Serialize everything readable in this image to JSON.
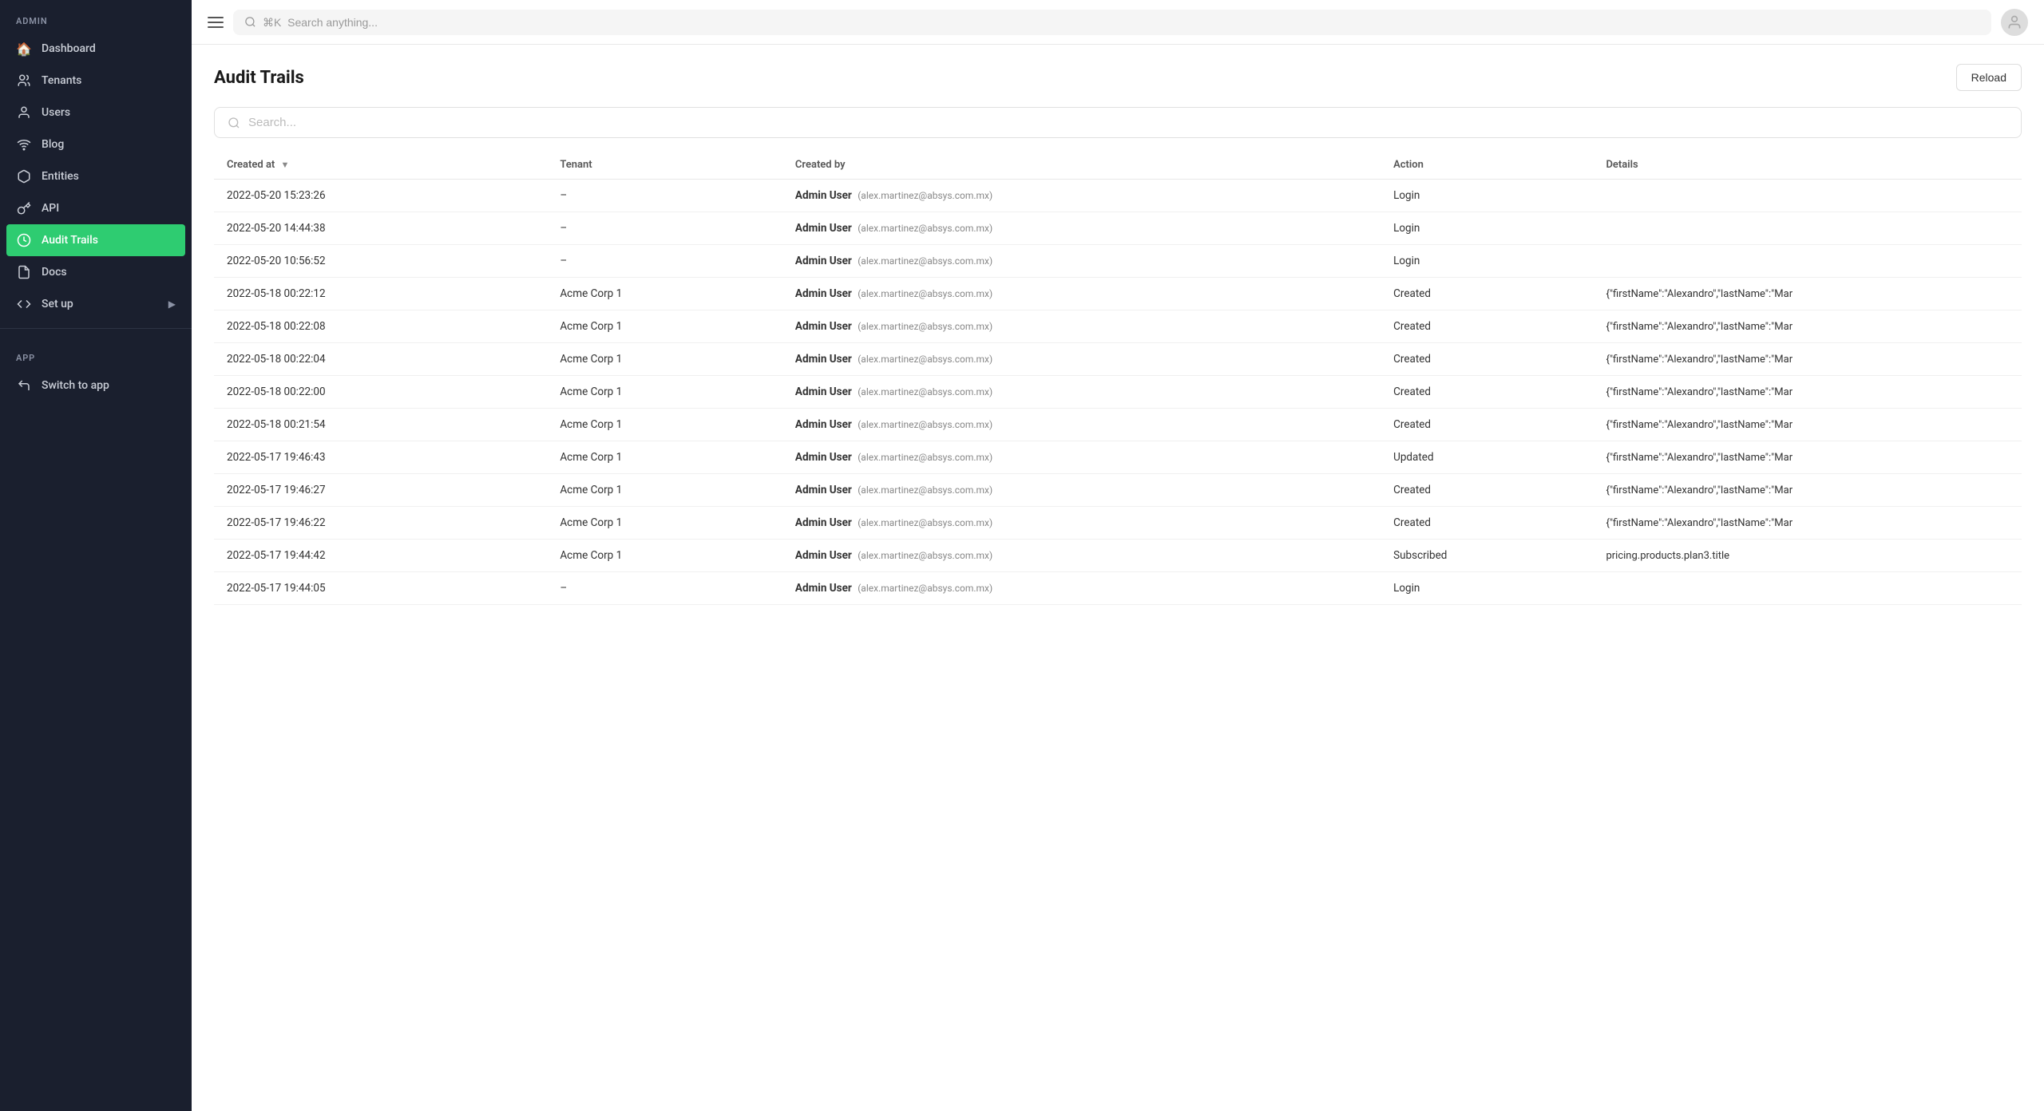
{
  "sidebar": {
    "admin_label": "ADMIN",
    "app_label": "APP",
    "items": [
      {
        "id": "dashboard",
        "label": "Dashboard",
        "icon": "🏠",
        "active": false
      },
      {
        "id": "tenants",
        "label": "Tenants",
        "icon": "👥",
        "active": false
      },
      {
        "id": "users",
        "label": "Users",
        "icon": "👤",
        "active": false
      },
      {
        "id": "blog",
        "label": "Blog",
        "icon": "📡",
        "active": false
      },
      {
        "id": "entities",
        "label": "Entities",
        "icon": "🧩",
        "active": false
      },
      {
        "id": "api",
        "label": "API",
        "icon": "🔑",
        "active": false
      },
      {
        "id": "audit-trails",
        "label": "Audit Trails",
        "icon": "🕐",
        "active": true
      },
      {
        "id": "docs",
        "label": "Docs",
        "icon": "📄",
        "active": false
      },
      {
        "id": "set-up",
        "label": "Set up",
        "icon": "</>",
        "active": false,
        "hasArrow": true
      }
    ],
    "app_items": [
      {
        "id": "switch-to-app",
        "label": "Switch to app",
        "icon": "↩",
        "active": false
      }
    ]
  },
  "topbar": {
    "search_placeholder": "⌘K  Search anything...",
    "search_shortcut": "⌘K"
  },
  "page": {
    "title": "Audit Trails",
    "reload_label": "Reload",
    "search_placeholder": "Search..."
  },
  "table": {
    "columns": [
      {
        "id": "created_at",
        "label": "Created at",
        "sortable": true
      },
      {
        "id": "tenant",
        "label": "Tenant",
        "sortable": false
      },
      {
        "id": "created_by",
        "label": "Created by",
        "sortable": false
      },
      {
        "id": "action",
        "label": "Action",
        "sortable": false
      },
      {
        "id": "details",
        "label": "Details",
        "sortable": false
      }
    ],
    "rows": [
      {
        "created_at": "2022-05-20 15:23:26",
        "tenant": "–",
        "created_by": "Admin User",
        "created_by_email": "alex.martinez@absys.com.mx",
        "action": "Login",
        "details": ""
      },
      {
        "created_at": "2022-05-20 14:44:38",
        "tenant": "–",
        "created_by": "Admin User",
        "created_by_email": "alex.martinez@absys.com.mx",
        "action": "Login",
        "details": ""
      },
      {
        "created_at": "2022-05-20 10:56:52",
        "tenant": "–",
        "created_by": "Admin User",
        "created_by_email": "alex.martinez@absys.com.mx",
        "action": "Login",
        "details": ""
      },
      {
        "created_at": "2022-05-18 00:22:12",
        "tenant": "Acme Corp 1",
        "created_by": "Admin User",
        "created_by_email": "alex.martinez@absys.com.mx",
        "action": "Created",
        "details": "{\"firstName\":\"Alexandro\",\"lastName\":\"Mar"
      },
      {
        "created_at": "2022-05-18 00:22:08",
        "tenant": "Acme Corp 1",
        "created_by": "Admin User",
        "created_by_email": "alex.martinez@absys.com.mx",
        "action": "Created",
        "details": "{\"firstName\":\"Alexandro\",\"lastName\":\"Mar"
      },
      {
        "created_at": "2022-05-18 00:22:04",
        "tenant": "Acme Corp 1",
        "created_by": "Admin User",
        "created_by_email": "alex.martinez@absys.com.mx",
        "action": "Created",
        "details": "{\"firstName\":\"Alexandro\",\"lastName\":\"Mar"
      },
      {
        "created_at": "2022-05-18 00:22:00",
        "tenant": "Acme Corp 1",
        "created_by": "Admin User",
        "created_by_email": "alex.martinez@absys.com.mx",
        "action": "Created",
        "details": "{\"firstName\":\"Alexandro\",\"lastName\":\"Mar"
      },
      {
        "created_at": "2022-05-18 00:21:54",
        "tenant": "Acme Corp 1",
        "created_by": "Admin User",
        "created_by_email": "alex.martinez@absys.com.mx",
        "action": "Created",
        "details": "{\"firstName\":\"Alexandro\",\"lastName\":\"Mar"
      },
      {
        "created_at": "2022-05-17 19:46:43",
        "tenant": "Acme Corp 1",
        "created_by": "Admin User",
        "created_by_email": "alex.martinez@absys.com.mx",
        "action": "Updated",
        "details": "{\"firstName\":\"Alexandro\",\"lastName\":\"Mar"
      },
      {
        "created_at": "2022-05-17 19:46:27",
        "tenant": "Acme Corp 1",
        "created_by": "Admin User",
        "created_by_email": "alex.martinez@absys.com.mx",
        "action": "Created",
        "details": "{\"firstName\":\"Alexandro\",\"lastName\":\"Mar"
      },
      {
        "created_at": "2022-05-17 19:46:22",
        "tenant": "Acme Corp 1",
        "created_by": "Admin User",
        "created_by_email": "alex.martinez@absys.com.mx",
        "action": "Created",
        "details": "{\"firstName\":\"Alexandro\",\"lastName\":\"Mar"
      },
      {
        "created_at": "2022-05-17 19:44:42",
        "tenant": "Acme Corp 1",
        "created_by": "Admin User",
        "created_by_email": "alex.martinez@absys.com.mx",
        "action": "Subscribed",
        "details": "pricing.products.plan3.title"
      },
      {
        "created_at": "2022-05-17 19:44:05",
        "tenant": "–",
        "created_by": "Admin User",
        "created_by_email": "alex.martinez@absys.com.mx",
        "action": "Login",
        "details": ""
      }
    ]
  }
}
